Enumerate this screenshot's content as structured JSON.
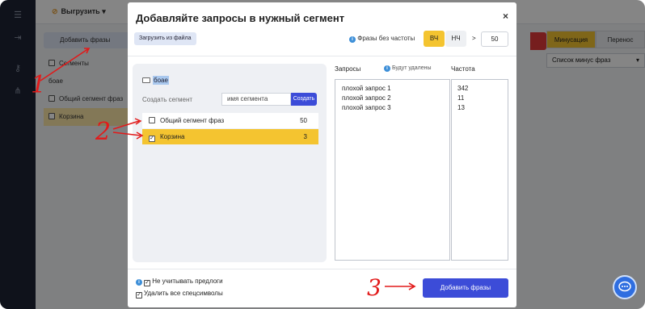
{
  "app": {
    "export_label": "Выгрузить",
    "add_phrases_label": "Добавить фразы",
    "tree": {
      "header": "Сегменты",
      "folder": "боае",
      "items": [
        "Общий сегмент фраз",
        "Корзина"
      ]
    },
    "right": {
      "tab_minus": "Минусация",
      "tab_transfer": "Перенос",
      "minus_list": "Список минус фраз"
    }
  },
  "modal": {
    "title": "Добавляйте запросы в нужный сегмент",
    "close": "×",
    "load_file": "Загрузить из файла",
    "no_freq_label": "Фразы без частоты",
    "vch": "ВЧ",
    "nch": "НЧ",
    "gt": ">",
    "threshold": "50",
    "folder_name": "боае",
    "create_segment_label": "Создать сегмент",
    "segment_name_placeholder": "имя сегмента",
    "create_button": "Создать",
    "segments": [
      {
        "label": "Общий сегмент фраз",
        "count": "50",
        "checked": false
      },
      {
        "label": "Корзина",
        "count": "3",
        "checked": true
      }
    ],
    "queries_label": "Запросы",
    "will_be_deleted": "Будут удалены",
    "frequency_label": "Частота",
    "queries": [
      "плохой запрос 1",
      "плохой запрос 2",
      "плохой запрос 3"
    ],
    "frequencies": [
      "342",
      "11",
      "13"
    ],
    "option_prepositions": "Не учитывать предлоги",
    "option_specials": "Удалить все спецсимволы",
    "submit": "Добавить фразы"
  },
  "annotations": {
    "one": "1",
    "two": "2",
    "three": "3"
  },
  "colors": {
    "accent_yellow": "#f4c430",
    "primary_blue": "#3c4cd8",
    "annotation_red": "#e21a1a"
  }
}
